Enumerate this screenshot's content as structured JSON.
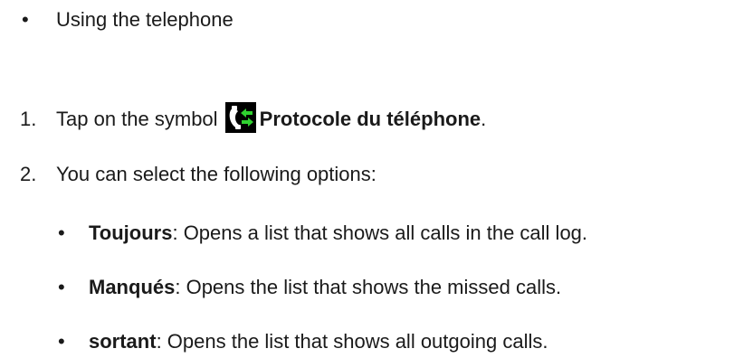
{
  "intro": {
    "bullet": "•",
    "text": "Using the telephone"
  },
  "steps": [
    {
      "number": "1.",
      "before": "Tap on the symbol",
      "icon": "phone-log-icon",
      "bold": "Protocole du téléphone",
      "after": "."
    },
    {
      "number": "2.",
      "text": "You can select the following options:"
    }
  ],
  "options": [
    {
      "bullet": "•",
      "term": "Toujours",
      "desc": ": Opens a list that shows all calls in the call log."
    },
    {
      "bullet": "•",
      "term": "Manqués",
      "desc": ": Opens the list that shows the missed calls."
    },
    {
      "bullet": "•",
      "term": "sortant",
      "desc": ": Opens the list that shows all outgoing calls."
    }
  ],
  "colors": {
    "text": "#1a1a1a",
    "icon_background": "#000000",
    "icon_phone": "#ffffff",
    "icon_arrows": "#2fd12f"
  }
}
